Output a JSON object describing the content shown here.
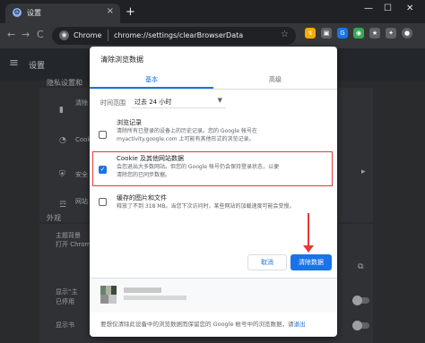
{
  "browser": {
    "tab_title": "设置",
    "tab_favicon_glyph": "⚙",
    "tab_close_glyph": "×",
    "new_tab_glyph": "+",
    "window_controls": {
      "minimize": "—",
      "maximize": "☐",
      "close": "✕"
    },
    "omnibox": {
      "origin": "Chrome",
      "url": "chrome://settings/clearBrowserData"
    },
    "nav": {
      "back": "←",
      "forward": "→",
      "reload": "C"
    },
    "star_glyph": "☆",
    "extensions": [
      {
        "name": "ext-1",
        "glyph": "↯",
        "color": "#f9ab00"
      },
      {
        "name": "ext-2",
        "glyph": "▣",
        "color": "#5f6368"
      },
      {
        "name": "ext-3",
        "glyph": "G",
        "color": "#1a73e8"
      },
      {
        "name": "ext-4",
        "glyph": "◉",
        "color": "#34a853"
      },
      {
        "name": "ext-5",
        "glyph": "★",
        "color": "#5f6368"
      },
      {
        "name": "ext-6",
        "glyph": "✦",
        "color": "#5f6368"
      }
    ]
  },
  "settings_page": {
    "menu_glyph": "≡",
    "title": "设置",
    "privacy_heading": "隐私设置和",
    "rows": [
      {
        "label": "清除",
        "icon": "▮"
      },
      {
        "label": "Cook",
        "icon": "◔"
      },
      {
        "label": "安全",
        "icon": "⛨"
      },
      {
        "label": "网站",
        "icon": "☲"
      }
    ],
    "appearance_heading": "外观",
    "theme_title": "主题背景",
    "theme_desc": "打开 Chrome",
    "show_a": "显示“主",
    "show_a_sub": "已停用",
    "show_b": "显示书"
  },
  "dialog": {
    "title": "清除浏览数据",
    "tabs": {
      "basic": "基本",
      "advanced": "高级"
    },
    "time_range_label": "时间范围",
    "time_range_value": "过去 24 小时",
    "caret": "▼",
    "items": [
      {
        "title": "浏览记录",
        "desc1": "清除所有已登录的设备上的历史记录。您的 Google 帐号在",
        "desc2": "myactivity.google.com 上可能有其他形式的浏览记录。",
        "checked": false
      },
      {
        "title": "Cookie 及其他网站数据",
        "desc1": "会您退出大多数网站。但您的 Google 帐号仍会保持登录状态，以便",
        "desc2": "清除您的已同步数据。",
        "checked": true
      },
      {
        "title": "缓存的图片和文件",
        "desc1": "释放了不到 318 MB。当您下次访问时，某些网站的加载速度可能会变慢。",
        "desc2": "",
        "checked": false
      }
    ],
    "check_glyph": "✓",
    "cancel_label": "取消",
    "clear_label": "清除数据",
    "footer_text": "要想仅清除此设备中的浏览数据而保留您的 Google 帐号中的浏览数据，请",
    "footer_link": "退出"
  },
  "colors": {
    "accent": "#1a73e8",
    "annotation_red": "#e53935"
  }
}
